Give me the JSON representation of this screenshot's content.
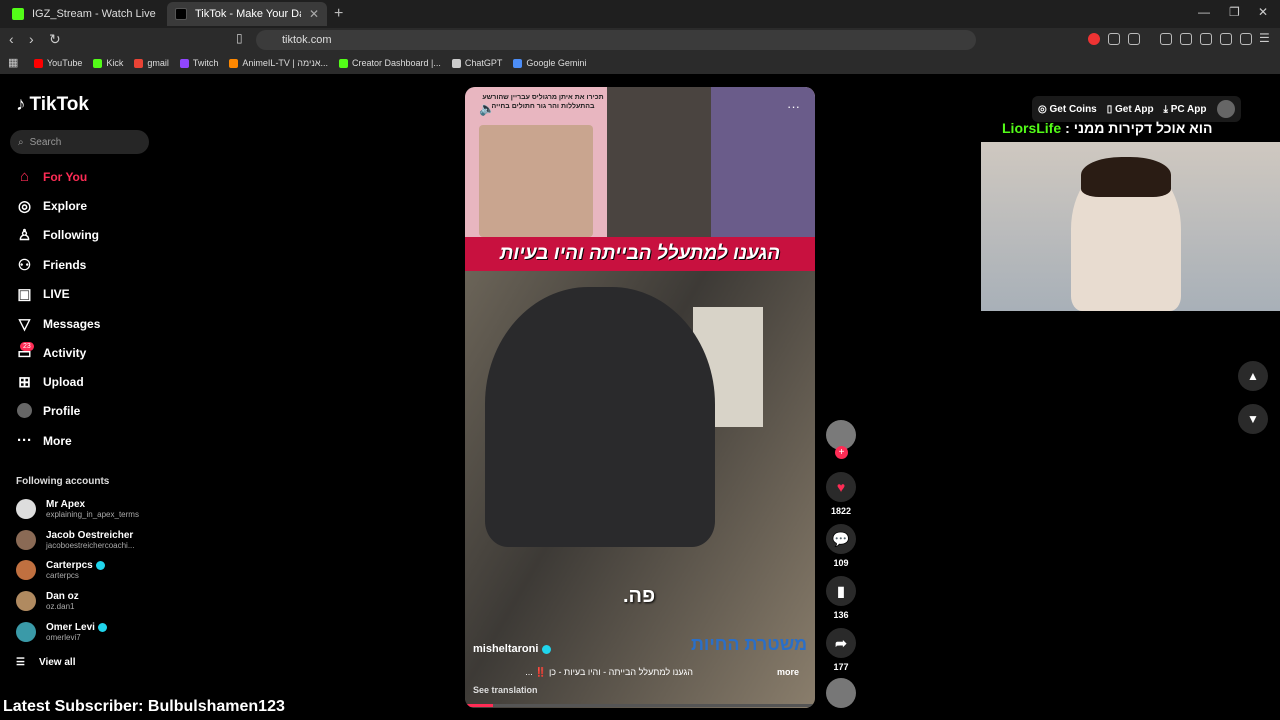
{
  "browser": {
    "tabs": [
      {
        "title": "IGZ_Stream - Watch Live on Kick",
        "favicon_color": "#53fc18"
      },
      {
        "title": "TikTok - Make Your Day",
        "favicon_color": "#000000"
      }
    ],
    "url": "tiktok.com",
    "bookmarks": [
      {
        "label": "YouTube",
        "color": "#ff0000"
      },
      {
        "label": "Kick",
        "color": "#53fc18"
      },
      {
        "label": "gmail",
        "color": "#ea4335"
      },
      {
        "label": "Twitch",
        "color": "#9146ff"
      },
      {
        "label": "AnimeIL-TV | אנימה...",
        "color": "#ff8800"
      },
      {
        "label": "Creator Dashboard |...",
        "color": "#53fc18"
      },
      {
        "label": "ChatGPT",
        "color": "#cccccc"
      },
      {
        "label": "Google Gemini",
        "color": "#4c8df6"
      }
    ]
  },
  "tiktok": {
    "logo": "TikTok",
    "search_placeholder": "Search",
    "nav": [
      {
        "label": "For You",
        "icon": "home-icon",
        "active": true
      },
      {
        "label": "Explore",
        "icon": "compass-icon"
      },
      {
        "label": "Following",
        "icon": "following-icon"
      },
      {
        "label": "Friends",
        "icon": "friends-icon"
      },
      {
        "label": "LIVE",
        "icon": "live-icon"
      },
      {
        "label": "Messages",
        "icon": "messages-icon"
      },
      {
        "label": "Activity",
        "icon": "activity-icon",
        "badge": "23"
      },
      {
        "label": "Upload",
        "icon": "upload-icon"
      },
      {
        "label": "Profile",
        "icon": "profile-icon"
      },
      {
        "label": "More",
        "icon": "more-icon"
      }
    ],
    "following_title": "Following accounts",
    "accounts": [
      {
        "name": "Mr Apex",
        "handle": "explaining_in_apex_terms",
        "verified": false
      },
      {
        "name": "Jacob Oestreicher",
        "handle": "jacoboestreichercoachi...",
        "verified": false
      },
      {
        "name": "Carterpcs",
        "handle": "carterpcs",
        "verified": true
      },
      {
        "name": "Dan oz",
        "handle": "oz.dan1",
        "verified": false
      },
      {
        "name": "Omer Levi",
        "handle": "omerlevi7",
        "verified": true
      }
    ],
    "view_all": "View all",
    "video": {
      "top_text": "תכירו את איתן מרגוליס עבריין שהורשע בהתעללות והר גור חתולים בחייה",
      "headline": "הגענו למתעלל הבייתה והיו בעיות",
      "overlay": "פה.",
      "watermark": "משטרת החיות",
      "author": "misheltaroni",
      "caption": "הגענו למתעלל הבייתה - והיו בעיות - כן ‼️ ...",
      "more": "more",
      "see_translation": "See translation"
    },
    "actions": {
      "likes": "1822",
      "comments": "109",
      "saves": "136",
      "shares": "177"
    },
    "top_right": {
      "get_coins": "Get Coins",
      "get_app": "Get App",
      "pc_app": "PC App"
    }
  },
  "stream": {
    "chat_user": "LiorsLife",
    "chat_message": "הוא אוכל דקירות ממני",
    "latest_subscriber": "Latest Subscriber: Bulbulshamen123"
  }
}
